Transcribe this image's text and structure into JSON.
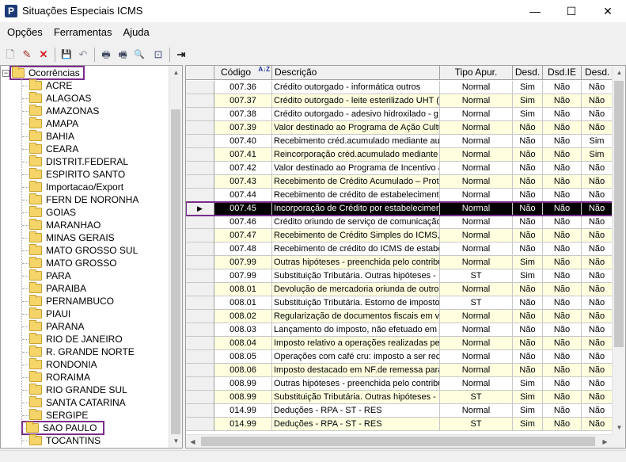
{
  "window": {
    "title": "Situações Especiais ICMS",
    "app_icon_letter": "P",
    "minimize_glyph": "—",
    "maximize_glyph": "☐",
    "close_glyph": "✕"
  },
  "menu": [
    "Opções",
    "Ferramentas",
    "Ajuda"
  ],
  "toolbar": {
    "icons": [
      "new-document-icon",
      "edit-pencil-icon",
      "delete-x-icon",
      "save-icon",
      "undo-icon",
      "print-icon",
      "print-preview-icon",
      "search-icon",
      "filter-icon",
      "exit-door-icon"
    ],
    "glyphs": [
      "🗋",
      "✎",
      "✕",
      "💾",
      "↶",
      "🖶",
      "🖷",
      "🔍",
      "⊡",
      "⇥"
    ]
  },
  "tree": {
    "root_label": "Ocorrências",
    "expander": "−",
    "items": [
      "ACRE",
      "ALAGOAS",
      "AMAZONAS",
      "AMAPA",
      "BAHIA",
      "CEARA",
      "DISTRIT.FEDERAL",
      "ESPIRITO SANTO",
      "Importacao/Export",
      "FERN DE NORONHA",
      "GOIAS",
      "MARANHAO",
      "MINAS GERAIS",
      "MATO GROSSO SUL",
      "MATO GROSSO",
      "PARA",
      "PARAIBA",
      "PERNAMBUCO",
      "PIAUI",
      "PARANA",
      "RIO DE JANEIRO",
      "R. GRANDE NORTE",
      "RONDONIA",
      "RORAIMA",
      "RIO GRANDE SUL",
      "SANTA CATARINA",
      "SERGIPE",
      "SAO PAULO",
      "TOCANTINS"
    ],
    "highlighted_item": "SAO PAULO"
  },
  "grid": {
    "headers": {
      "code": "Código",
      "desc": "Descrição",
      "tipo": "Tipo Apur.",
      "d1": "Desd.",
      "d2": "Dsd.IE",
      "d3": "Desd."
    },
    "sort_glyph": "A↓Z",
    "selected_indicator": "▶",
    "rows": [
      {
        "code": "007.36",
        "desc": "Crédito outorgado - informática outros",
        "tipo": "Normal",
        "d1": "Sim",
        "d2": "Não",
        "d3": "Não"
      },
      {
        "code": "007.37",
        "desc": "Crédito outorgado - leite esterilizado UHT (l",
        "tipo": "Normal",
        "d1": "Sim",
        "d2": "Não",
        "d3": "Não"
      },
      {
        "code": "007.38",
        "desc": "Crédito outorgado - adesivo hidroxilado - g",
        "tipo": "Normal",
        "d1": "Sim",
        "d2": "Não",
        "d3": "Não"
      },
      {
        "code": "007.39",
        "desc": "Valor destinado ao Programa de Ação Cultu",
        "tipo": "Normal",
        "d1": "Não",
        "d2": "Não",
        "d3": "Não"
      },
      {
        "code": "007.40",
        "desc": "Recebimento créd.acumulado mediante aut",
        "tipo": "Normal",
        "d1": "Não",
        "d2": "Não",
        "d3": "Sim"
      },
      {
        "code": "007.41",
        "desc": "Reincorporação créd.acumulado mediante a",
        "tipo": "Normal",
        "d1": "Não",
        "d2": "Não",
        "d3": "Sim"
      },
      {
        "code": "007.42",
        "desc": "Valor destinado ao Programa de Incentivo a",
        "tipo": "Normal",
        "d1": "Não",
        "d2": "Não",
        "d3": "Não"
      },
      {
        "code": "007.43",
        "desc": "Recebimento de Crédito Acumulado – Protc",
        "tipo": "Normal",
        "d1": "Não",
        "d2": "Não",
        "d3": "Não"
      },
      {
        "code": "007.44",
        "desc": "Recebimento de crédito de estabelecimento",
        "tipo": "Normal",
        "d1": "Não",
        "d2": "Não",
        "d3": "Não"
      },
      {
        "code": "007.45",
        "desc": "Incorporação de Crédito por estabelecimen",
        "tipo": "Normal",
        "d1": "Não",
        "d2": "Não",
        "d3": "Não"
      },
      {
        "code": "007.46",
        "desc": "Crédito oriundo de serviço de comunicação",
        "tipo": "Normal",
        "d1": "Não",
        "d2": "Não",
        "d3": "Não"
      },
      {
        "code": "007.47",
        "desc": "Recebimento de Crédito Simples do ICMS, a",
        "tipo": "Normal",
        "d1": "Não",
        "d2": "Não",
        "d3": "Não"
      },
      {
        "code": "007.48",
        "desc": "Recebimento de crédito do ICMS de estabe",
        "tipo": "Normal",
        "d1": "Não",
        "d2": "Não",
        "d3": "Não"
      },
      {
        "code": "007.99",
        "desc": "Outras hipóteses - preenchida pelo contribu",
        "tipo": "Normal",
        "d1": "Sim",
        "d2": "Não",
        "d3": "Não"
      },
      {
        "code": "007.99",
        "desc": "Substituição Tributária. Outras hipóteses -",
        "tipo": "ST",
        "d1": "Sim",
        "d2": "Não",
        "d3": "Não"
      },
      {
        "code": "008.01",
        "desc": "Devolução de mercadoria oriunda de outro",
        "tipo": "Normal",
        "d1": "Não",
        "d2": "Não",
        "d3": "Não"
      },
      {
        "code": "008.01",
        "desc": "Substituição Tributária. Estorno de imposto",
        "tipo": "ST",
        "d1": "Não",
        "d2": "Não",
        "d3": "Não"
      },
      {
        "code": "008.02",
        "desc": "Regularização de documentos fiscais em vir",
        "tipo": "Normal",
        "d1": "Não",
        "d2": "Não",
        "d3": "Não"
      },
      {
        "code": "008.03",
        "desc": "Lançamento do imposto, não efetuado em",
        "tipo": "Normal",
        "d1": "Não",
        "d2": "Não",
        "d3": "Não"
      },
      {
        "code": "008.04",
        "desc": "Imposto relativo a operações realizadas pe",
        "tipo": "Normal",
        "d1": "Não",
        "d2": "Não",
        "d3": "Não"
      },
      {
        "code": "008.05",
        "desc": "Operações com café cru: imposto a ser rec",
        "tipo": "Normal",
        "d1": "Não",
        "d2": "Não",
        "d3": "Não"
      },
      {
        "code": "008.06",
        "desc": "Imposto destacado em NF.de remessa para",
        "tipo": "Normal",
        "d1": "Não",
        "d2": "Não",
        "d3": "Não"
      },
      {
        "code": "008.99",
        "desc": "Outras hipóteses - preenchida pelo contribu",
        "tipo": "Normal",
        "d1": "Sim",
        "d2": "Não",
        "d3": "Não"
      },
      {
        "code": "008.99",
        "desc": "Substituição Tributária. Outras hipóteses -",
        "tipo": "ST",
        "d1": "Sim",
        "d2": "Não",
        "d3": "Não"
      },
      {
        "code": "014.99",
        "desc": "Deduções - RPA - ST - RES",
        "tipo": "Normal",
        "d1": "Sim",
        "d2": "Não",
        "d3": "Não"
      },
      {
        "code": "014.99",
        "desc": "Deduções - RPA - ST - RES",
        "tipo": "ST",
        "d1": "Sim",
        "d2": "Não",
        "d3": "Não"
      }
    ],
    "selected_index": 9
  },
  "scroll_glyphs": {
    "up": "▲",
    "down": "▼",
    "left": "◀",
    "right": "▶"
  },
  "colors": {
    "highlight": "#7a2d8a",
    "alt_row": "#ffffe0",
    "selected_row": "#000000"
  }
}
